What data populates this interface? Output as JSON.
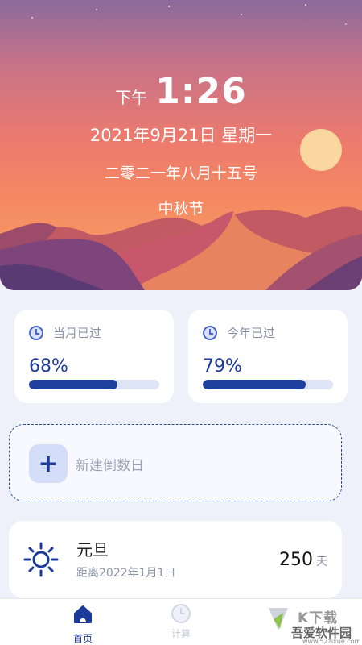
{
  "hero": {
    "ampm": "下午",
    "time": "1:26",
    "date": "2021年9月21日  星期一",
    "lunar_date": "二零二一年八月十五号",
    "festival": "中秋节"
  },
  "progress": {
    "month": {
      "title": "当月已过",
      "value": "68%",
      "fraction": 0.68,
      "icon": "clock-icon"
    },
    "year": {
      "title": "今年已过",
      "value": "79%",
      "fraction": 0.79,
      "icon": "clock-icon"
    }
  },
  "new_countdown": {
    "label": "新建倒数日",
    "icon": "plus-icon"
  },
  "events": [
    {
      "icon": "sun-icon",
      "title": "元旦",
      "subtitle": "距离2022年1月1日",
      "days": "250",
      "unit": "天"
    }
  ],
  "tabbar": {
    "home": {
      "label": "首页",
      "icon": "home-icon"
    },
    "calc": {
      "label": "计算",
      "icon": "clock-icon"
    },
    "settings": {
      "label": "",
      "icon": "settings-icon"
    }
  },
  "watermark": {
    "line1": "K下载",
    "line2": "吾爱软件园",
    "line3": "www.52zixue.com"
  },
  "colors": {
    "accent": "#1c3a9a",
    "bar_track": "#dde4f6",
    "page_bg": "#eef1fa"
  }
}
